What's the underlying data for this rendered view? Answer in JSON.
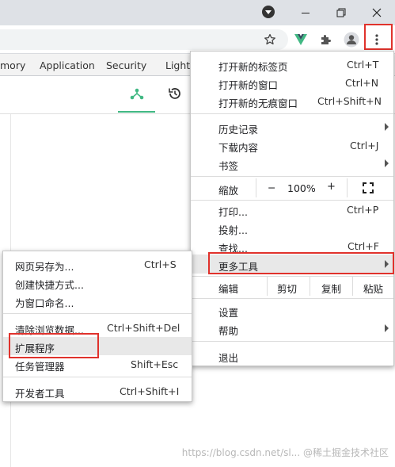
{
  "devtools": {
    "tabs": [
      "mory",
      "Application",
      "Security",
      "Lighth"
    ]
  },
  "main_menu": {
    "new_tab": {
      "label": "打开新的标签页",
      "shortcut": "Ctrl+T"
    },
    "new_window": {
      "label": "打开新的窗口",
      "shortcut": "Ctrl+N"
    },
    "incognito": {
      "label": "打开新的无痕窗口",
      "shortcut": "Ctrl+Shift+N"
    },
    "history": {
      "label": "历史记录"
    },
    "downloads": {
      "label": "下载内容",
      "shortcut": "Ctrl+J"
    },
    "bookmarks": {
      "label": "书签"
    },
    "zoom": {
      "label": "缩放",
      "minus": "−",
      "value": "100%",
      "plus": "+"
    },
    "print": {
      "label": "打印...",
      "shortcut": "Ctrl+P"
    },
    "cast": {
      "label": "投射..."
    },
    "find": {
      "label": "查找...",
      "shortcut": "Ctrl+F"
    },
    "more_tools": {
      "label": "更多工具"
    },
    "edit": {
      "label": "编辑",
      "cut": "剪切",
      "copy": "复制",
      "paste": "粘贴"
    },
    "settings": {
      "label": "设置"
    },
    "help": {
      "label": "帮助"
    },
    "exit": {
      "label": "退出"
    }
  },
  "submenu": {
    "save_page": {
      "label": "网页另存为...",
      "shortcut": "Ctrl+S"
    },
    "create_shortcut": {
      "label": "创建快捷方式..."
    },
    "name_window": {
      "label": "为窗口命名..."
    },
    "clear_data": {
      "label": "清除浏览数据...",
      "shortcut": "Ctrl+Shift+Del"
    },
    "extensions": {
      "label": "扩展程序"
    },
    "task_manager": {
      "label": "任务管理器",
      "shortcut": "Shift+Esc"
    },
    "dev_tools": {
      "label": "开发者工具",
      "shortcut": "Ctrl+Shift+I"
    }
  },
  "watermark": "https://blog.csdn.net/sl... @稀土掘金技术社区",
  "colors": {
    "highlight_box": "#e0322c",
    "vue_green": "#41b883"
  }
}
